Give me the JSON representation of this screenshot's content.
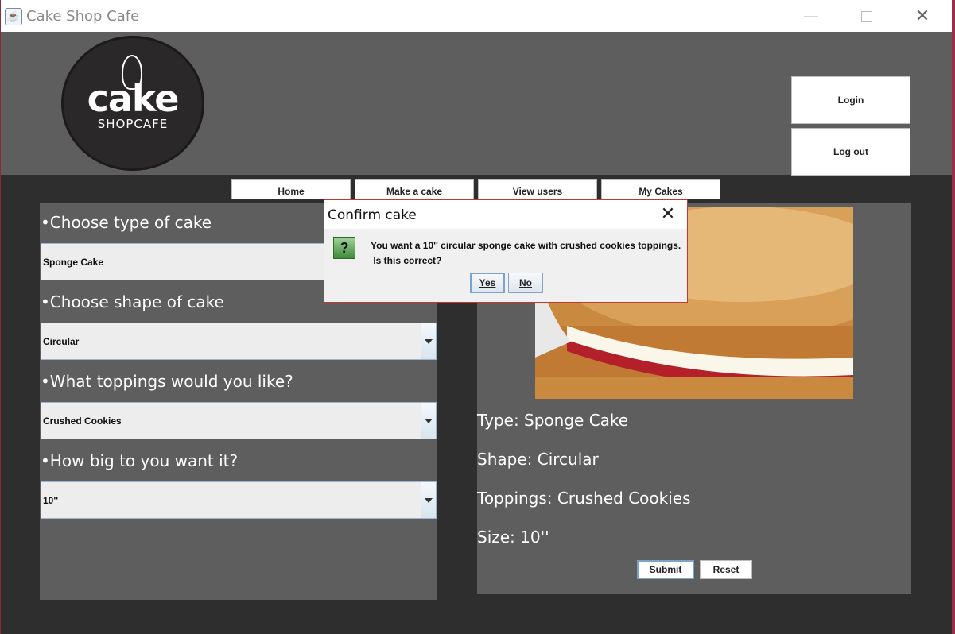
{
  "window": {
    "title": "Cake Shop Cafe"
  },
  "logo": {
    "text_big": "cake",
    "text_small": "SHOPCAFE"
  },
  "header": {
    "login_label": "Login",
    "logout_label": "Log out"
  },
  "nav": {
    "items": [
      {
        "label": "Home"
      },
      {
        "label": "Make a cake"
      },
      {
        "label": "View users"
      },
      {
        "label": "My Cakes"
      }
    ]
  },
  "form": {
    "type_label": "•Choose type of cake",
    "type_value": "Sponge Cake",
    "shape_label": "•Choose shape of cake",
    "shape_value": "Circular",
    "toppings_label": "•What toppings would you like?",
    "toppings_value": "Crushed Cookies",
    "size_label": "•How big to you want it?",
    "size_value": "10''"
  },
  "summary": {
    "type": "Type: Sponge Cake",
    "shape": "Shape: Circular",
    "toppings": "Toppings: Crushed Cookies",
    "size": "Size: 10''",
    "submit_label": "Submit",
    "reset_label": "Reset"
  },
  "dialog": {
    "title": "Confirm cake",
    "message_line1": "You want a 10'' circular sponge cake with crushed cookies toppings.",
    "message_line2": " Is this correct?",
    "yes_label": "Yes",
    "no_label": "No"
  }
}
